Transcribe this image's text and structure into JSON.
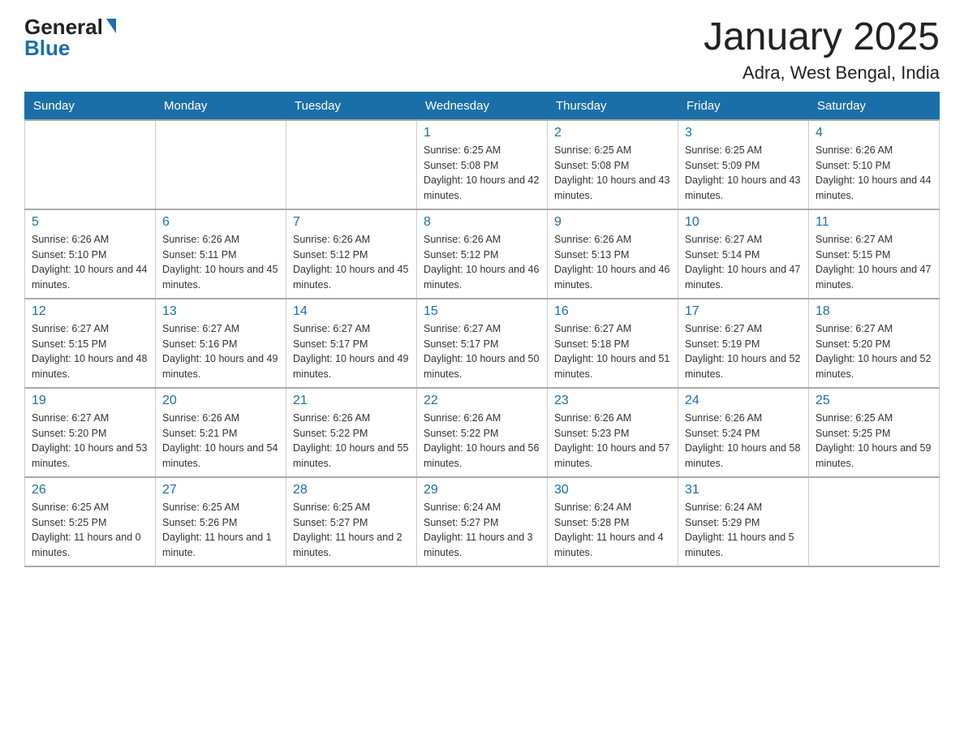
{
  "header": {
    "logo": {
      "general": "General",
      "blue": "Blue"
    },
    "title": "January 2025",
    "location": "Adra, West Bengal, India"
  },
  "weekdays": [
    "Sunday",
    "Monday",
    "Tuesday",
    "Wednesday",
    "Thursday",
    "Friday",
    "Saturday"
  ],
  "weeks": [
    [
      null,
      null,
      null,
      {
        "day": "1",
        "sunrise": "Sunrise: 6:25 AM",
        "sunset": "Sunset: 5:08 PM",
        "daylight": "Daylight: 10 hours and 42 minutes."
      },
      {
        "day": "2",
        "sunrise": "Sunrise: 6:25 AM",
        "sunset": "Sunset: 5:08 PM",
        "daylight": "Daylight: 10 hours and 43 minutes."
      },
      {
        "day": "3",
        "sunrise": "Sunrise: 6:25 AM",
        "sunset": "Sunset: 5:09 PM",
        "daylight": "Daylight: 10 hours and 43 minutes."
      },
      {
        "day": "4",
        "sunrise": "Sunrise: 6:26 AM",
        "sunset": "Sunset: 5:10 PM",
        "daylight": "Daylight: 10 hours and 44 minutes."
      }
    ],
    [
      {
        "day": "5",
        "sunrise": "Sunrise: 6:26 AM",
        "sunset": "Sunset: 5:10 PM",
        "daylight": "Daylight: 10 hours and 44 minutes."
      },
      {
        "day": "6",
        "sunrise": "Sunrise: 6:26 AM",
        "sunset": "Sunset: 5:11 PM",
        "daylight": "Daylight: 10 hours and 45 minutes."
      },
      {
        "day": "7",
        "sunrise": "Sunrise: 6:26 AM",
        "sunset": "Sunset: 5:12 PM",
        "daylight": "Daylight: 10 hours and 45 minutes."
      },
      {
        "day": "8",
        "sunrise": "Sunrise: 6:26 AM",
        "sunset": "Sunset: 5:12 PM",
        "daylight": "Daylight: 10 hours and 46 minutes."
      },
      {
        "day": "9",
        "sunrise": "Sunrise: 6:26 AM",
        "sunset": "Sunset: 5:13 PM",
        "daylight": "Daylight: 10 hours and 46 minutes."
      },
      {
        "day": "10",
        "sunrise": "Sunrise: 6:27 AM",
        "sunset": "Sunset: 5:14 PM",
        "daylight": "Daylight: 10 hours and 47 minutes."
      },
      {
        "day": "11",
        "sunrise": "Sunrise: 6:27 AM",
        "sunset": "Sunset: 5:15 PM",
        "daylight": "Daylight: 10 hours and 47 minutes."
      }
    ],
    [
      {
        "day": "12",
        "sunrise": "Sunrise: 6:27 AM",
        "sunset": "Sunset: 5:15 PM",
        "daylight": "Daylight: 10 hours and 48 minutes."
      },
      {
        "day": "13",
        "sunrise": "Sunrise: 6:27 AM",
        "sunset": "Sunset: 5:16 PM",
        "daylight": "Daylight: 10 hours and 49 minutes."
      },
      {
        "day": "14",
        "sunrise": "Sunrise: 6:27 AM",
        "sunset": "Sunset: 5:17 PM",
        "daylight": "Daylight: 10 hours and 49 minutes."
      },
      {
        "day": "15",
        "sunrise": "Sunrise: 6:27 AM",
        "sunset": "Sunset: 5:17 PM",
        "daylight": "Daylight: 10 hours and 50 minutes."
      },
      {
        "day": "16",
        "sunrise": "Sunrise: 6:27 AM",
        "sunset": "Sunset: 5:18 PM",
        "daylight": "Daylight: 10 hours and 51 minutes."
      },
      {
        "day": "17",
        "sunrise": "Sunrise: 6:27 AM",
        "sunset": "Sunset: 5:19 PM",
        "daylight": "Daylight: 10 hours and 52 minutes."
      },
      {
        "day": "18",
        "sunrise": "Sunrise: 6:27 AM",
        "sunset": "Sunset: 5:20 PM",
        "daylight": "Daylight: 10 hours and 52 minutes."
      }
    ],
    [
      {
        "day": "19",
        "sunrise": "Sunrise: 6:27 AM",
        "sunset": "Sunset: 5:20 PM",
        "daylight": "Daylight: 10 hours and 53 minutes."
      },
      {
        "day": "20",
        "sunrise": "Sunrise: 6:26 AM",
        "sunset": "Sunset: 5:21 PM",
        "daylight": "Daylight: 10 hours and 54 minutes."
      },
      {
        "day": "21",
        "sunrise": "Sunrise: 6:26 AM",
        "sunset": "Sunset: 5:22 PM",
        "daylight": "Daylight: 10 hours and 55 minutes."
      },
      {
        "day": "22",
        "sunrise": "Sunrise: 6:26 AM",
        "sunset": "Sunset: 5:22 PM",
        "daylight": "Daylight: 10 hours and 56 minutes."
      },
      {
        "day": "23",
        "sunrise": "Sunrise: 6:26 AM",
        "sunset": "Sunset: 5:23 PM",
        "daylight": "Daylight: 10 hours and 57 minutes."
      },
      {
        "day": "24",
        "sunrise": "Sunrise: 6:26 AM",
        "sunset": "Sunset: 5:24 PM",
        "daylight": "Daylight: 10 hours and 58 minutes."
      },
      {
        "day": "25",
        "sunrise": "Sunrise: 6:25 AM",
        "sunset": "Sunset: 5:25 PM",
        "daylight": "Daylight: 10 hours and 59 minutes."
      }
    ],
    [
      {
        "day": "26",
        "sunrise": "Sunrise: 6:25 AM",
        "sunset": "Sunset: 5:25 PM",
        "daylight": "Daylight: 11 hours and 0 minutes."
      },
      {
        "day": "27",
        "sunrise": "Sunrise: 6:25 AM",
        "sunset": "Sunset: 5:26 PM",
        "daylight": "Daylight: 11 hours and 1 minute."
      },
      {
        "day": "28",
        "sunrise": "Sunrise: 6:25 AM",
        "sunset": "Sunset: 5:27 PM",
        "daylight": "Daylight: 11 hours and 2 minutes."
      },
      {
        "day": "29",
        "sunrise": "Sunrise: 6:24 AM",
        "sunset": "Sunset: 5:27 PM",
        "daylight": "Daylight: 11 hours and 3 minutes."
      },
      {
        "day": "30",
        "sunrise": "Sunrise: 6:24 AM",
        "sunset": "Sunset: 5:28 PM",
        "daylight": "Daylight: 11 hours and 4 minutes."
      },
      {
        "day": "31",
        "sunrise": "Sunrise: 6:24 AM",
        "sunset": "Sunset: 5:29 PM",
        "daylight": "Daylight: 11 hours and 5 minutes."
      },
      null
    ]
  ]
}
